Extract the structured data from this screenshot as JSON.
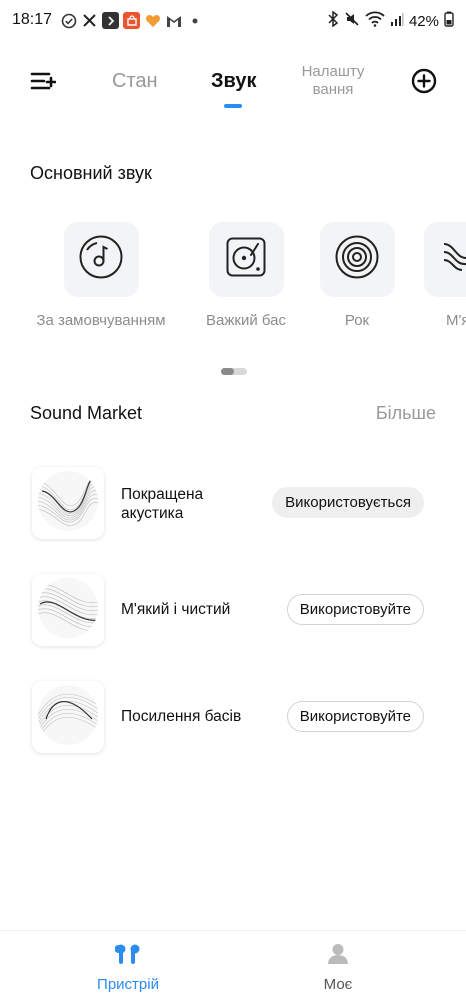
{
  "status_bar": {
    "time": "18:17",
    "battery": "42%",
    "left_icons": [
      "check-circle-icon",
      "x-logo-icon",
      "chevron-app-icon",
      "shopping-app-icon",
      "heart-app-icon",
      "gmail-icon",
      "dot-icon"
    ],
    "right_icons": [
      "bluetooth-icon",
      "mute-icon",
      "wifi-icon",
      "signal-icon"
    ]
  },
  "topnav": {
    "tabs": [
      {
        "label": "Стан"
      },
      {
        "label": "Звук"
      },
      {
        "label": "Налашту вання"
      }
    ],
    "active_tab": "Звук",
    "accent": "#2c8cf0"
  },
  "main_sound": {
    "title": "Основний звук",
    "presets": [
      {
        "label": "За замовчуванням",
        "icon": "music-note-disc-icon"
      },
      {
        "label": "Важкий бас",
        "icon": "turntable-icon"
      },
      {
        "label": "Рок",
        "icon": "vinyl-record-icon"
      },
      {
        "label": "М'як",
        "icon": "soft-waves-icon"
      }
    ]
  },
  "market": {
    "title": "Sound Market",
    "more": "Більше",
    "items": [
      {
        "name": "Покращена акустика",
        "button": "Використовується",
        "active": true
      },
      {
        "name": "М'який і чистий",
        "button": "Використовуйте",
        "active": false
      },
      {
        "name": "Посилення басів",
        "button": "Використовуйте",
        "active": false
      }
    ]
  },
  "bottom_nav": {
    "items": [
      {
        "label": "Пристрій",
        "icon": "earbuds-icon",
        "active": true
      },
      {
        "label": "Моє",
        "icon": "profile-icon",
        "active": false
      }
    ],
    "active_color": "#2c8cf0",
    "inactive_color": "#888888"
  }
}
